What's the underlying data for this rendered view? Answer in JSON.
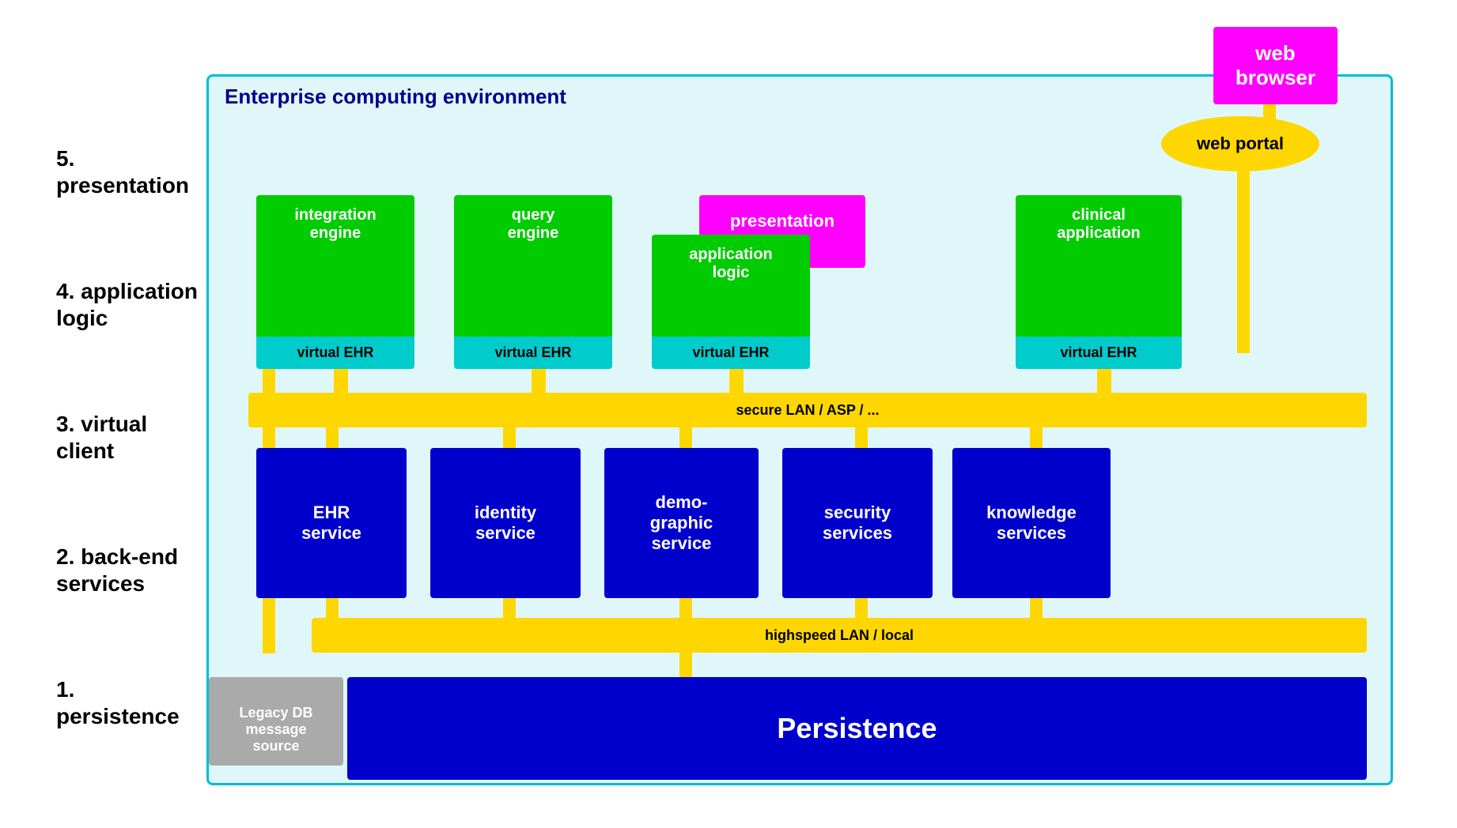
{
  "diagram": {
    "title": "Enterprise computing environment",
    "webBrowser": "web\nbrowser",
    "webPortal": "web portal",
    "presentationLayer": "presentation\nlayer",
    "layers": {
      "layer5": "5. presentation",
      "layer4": "4. application\nlogic",
      "layer3": "3. virtual client",
      "layer2": "2. back-end\nservices",
      "layer1": "1. persistence"
    },
    "appBlocks": [
      {
        "id": "integration",
        "green": "integration\nengine",
        "cyan": "virtual EHR"
      },
      {
        "id": "query",
        "green": "query\nengine",
        "cyan": "virtual EHR"
      },
      {
        "id": "applogic",
        "green": "application\nlogic",
        "cyan": "virtual EHR"
      },
      {
        "id": "clinical",
        "green": "clinical\napplication",
        "cyan": "virtual EHR"
      }
    ],
    "networkBars": {
      "secureLan": "secure LAN / ASP / ...",
      "highspeedLan": "highspeed LAN / local"
    },
    "serviceBoxes": [
      {
        "id": "ehr",
        "label": "EHR\nservice"
      },
      {
        "id": "identity",
        "label": "identity\nservice"
      },
      {
        "id": "demographic",
        "label": "demo-\ngraphic\nservice"
      },
      {
        "id": "security",
        "label": "security\nservices"
      },
      {
        "id": "knowledge",
        "label": "knowledge\nservices"
      }
    ],
    "legacyBox": "Legacy DB\nmessage\nsource",
    "persistenceBox": "Persistence"
  }
}
